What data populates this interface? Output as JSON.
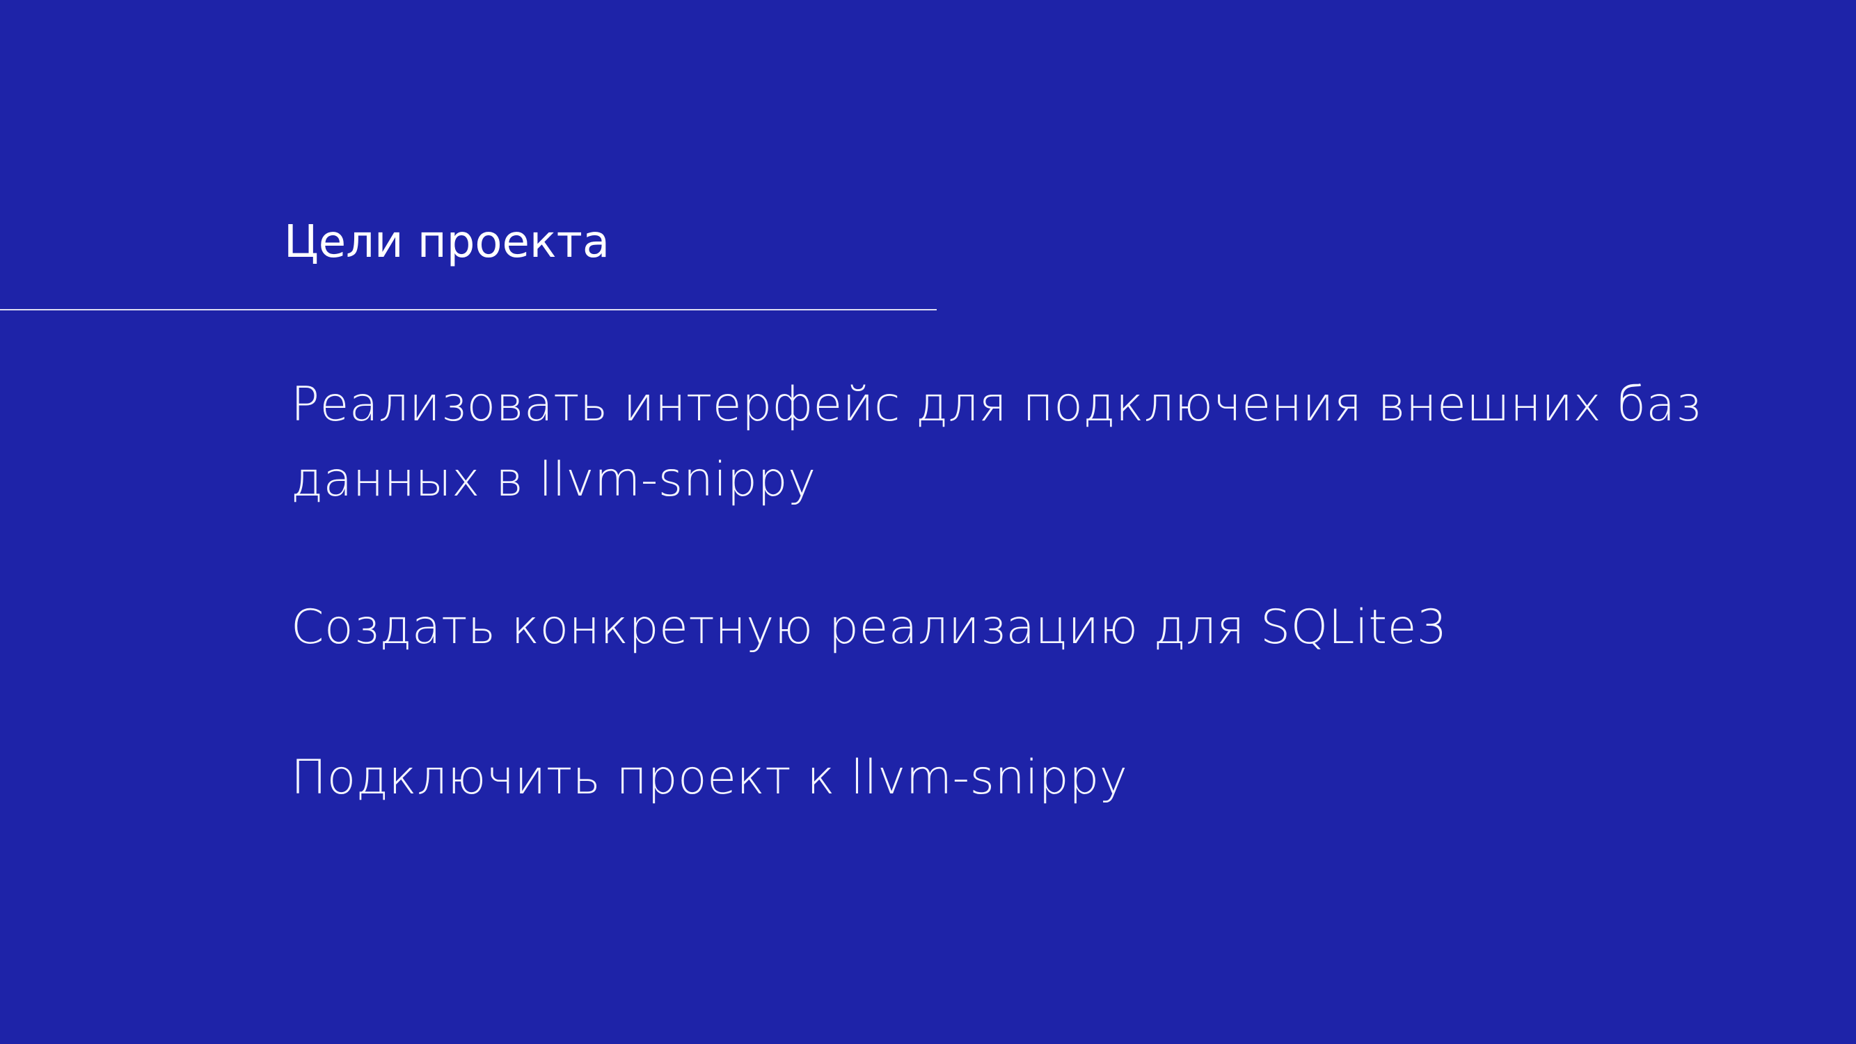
{
  "slide": {
    "background_color": "#1e23a8",
    "title": "Цели проекта",
    "goals": [
      {
        "line1": "Реализовать интерфейс для подключения внешних баз",
        "line2": "данных в llvm-snippy"
      },
      {
        "line1": "Создать конкретную реализацию для SQLite3"
      },
      {
        "line1": "Подключить проект к llvm-snippy"
      }
    ]
  }
}
